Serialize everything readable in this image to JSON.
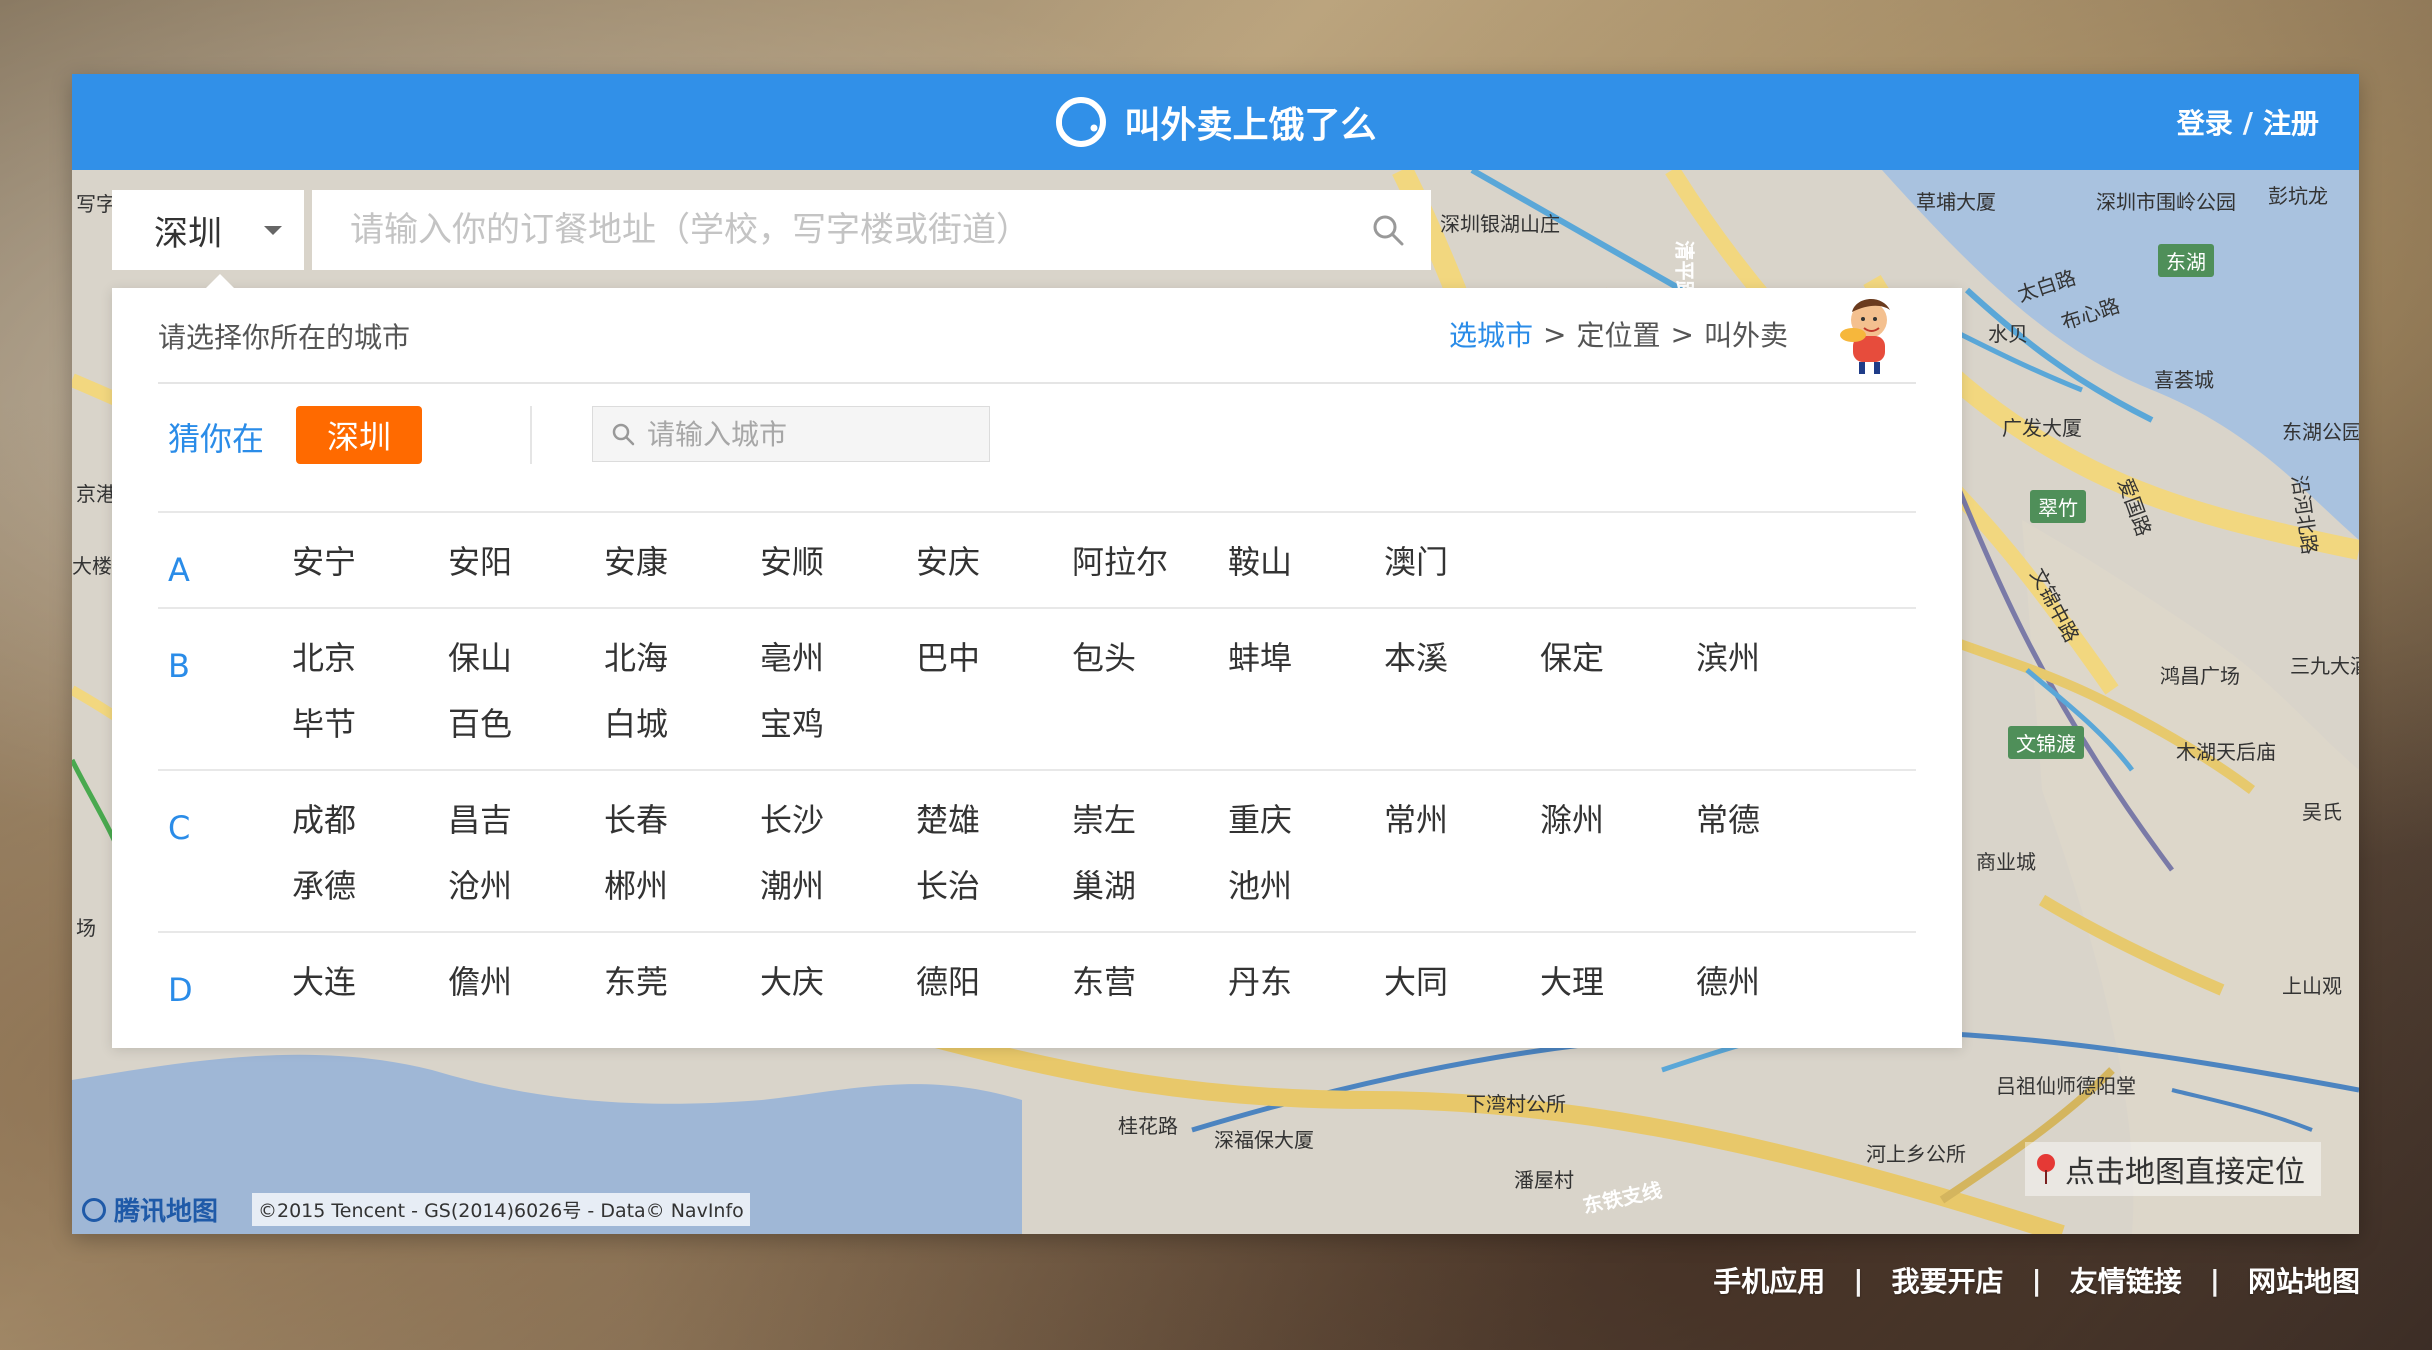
{
  "header": {
    "brand": "叫外卖上饿了么",
    "login": "登录",
    "separator": "/",
    "register": "注册"
  },
  "search": {
    "selected_city": "深圳",
    "placeholder": "请输入你的订餐地址（学校，写字楼或街道）"
  },
  "city_panel": {
    "title": "请选择你所在的城市",
    "breadcrumb": {
      "step1": "选城市",
      "step2": "定位置",
      "step3": "叫外卖",
      "sep": ">"
    },
    "guess_label": "猜你在",
    "guess_city": "深圳",
    "city_search_placeholder": "请输入城市",
    "groups": [
      {
        "letter": "A",
        "cities": [
          "安宁",
          "安阳",
          "安康",
          "安顺",
          "安庆",
          "阿拉尔",
          "鞍山",
          "澳门"
        ]
      },
      {
        "letter": "B",
        "cities": [
          "北京",
          "保山",
          "北海",
          "亳州",
          "巴中",
          "包头",
          "蚌埠",
          "本溪",
          "保定",
          "滨州",
          "毕节",
          "百色",
          "白城",
          "宝鸡"
        ]
      },
      {
        "letter": "C",
        "cities": [
          "成都",
          "昌吉",
          "长春",
          "长沙",
          "楚雄",
          "崇左",
          "重庆",
          "常州",
          "滁州",
          "常德",
          "承德",
          "沧州",
          "郴州",
          "潮州",
          "长治",
          "巢湖",
          "池州"
        ]
      },
      {
        "letter": "D",
        "cities": [
          "大连",
          "儋州",
          "东莞",
          "大庆",
          "德阳",
          "东营",
          "丹东",
          "大同",
          "大理",
          "德州"
        ]
      }
    ]
  },
  "map": {
    "labels": [
      "草埔大厦",
      "深圳市围岭公园",
      "彭坑龙",
      "东湖",
      "太白路",
      "布心路",
      "水贝",
      "喜荟城",
      "广发大厦",
      "东湖公园",
      "翠竹",
      "爱国路",
      "沿河北路",
      "文锦中路",
      "鸿昌广场",
      "三九大酒店",
      "文锦渡",
      "木湖天后庙",
      "吴氏",
      "商业城",
      "桂花路",
      "深福保大厦",
      "下湾村公所",
      "河上乡公所",
      "潘屋村",
      "吕祖仙师德阳堂",
      "东铁支线",
      "深圳银湖山庄",
      "清平路",
      "上山观",
      "写字",
      "大楼",
      "京港",
      "场"
    ],
    "credit_logo": "腾讯地图",
    "copyright": "©2015 Tencent - GS(2014)6026号 - Data© NavInfo",
    "locate_text": "点击地图直接定位"
  },
  "footer": {
    "links": [
      "手机应用",
      "我要开店",
      "友情链接",
      "网站地图"
    ],
    "separator": "|"
  },
  "colors": {
    "header_blue": "#3190e8",
    "accent_orange": "#ff6a00",
    "link_blue": "#2a8ce8",
    "map_green": "#4f8f59"
  },
  "icons": {
    "brand": "eleme-logo-icon",
    "dropdown": "chevron-down-icon",
    "search": "search-icon",
    "city_search": "search-icon",
    "locate": "map-pin-icon",
    "mascot": "mascot-icon"
  }
}
